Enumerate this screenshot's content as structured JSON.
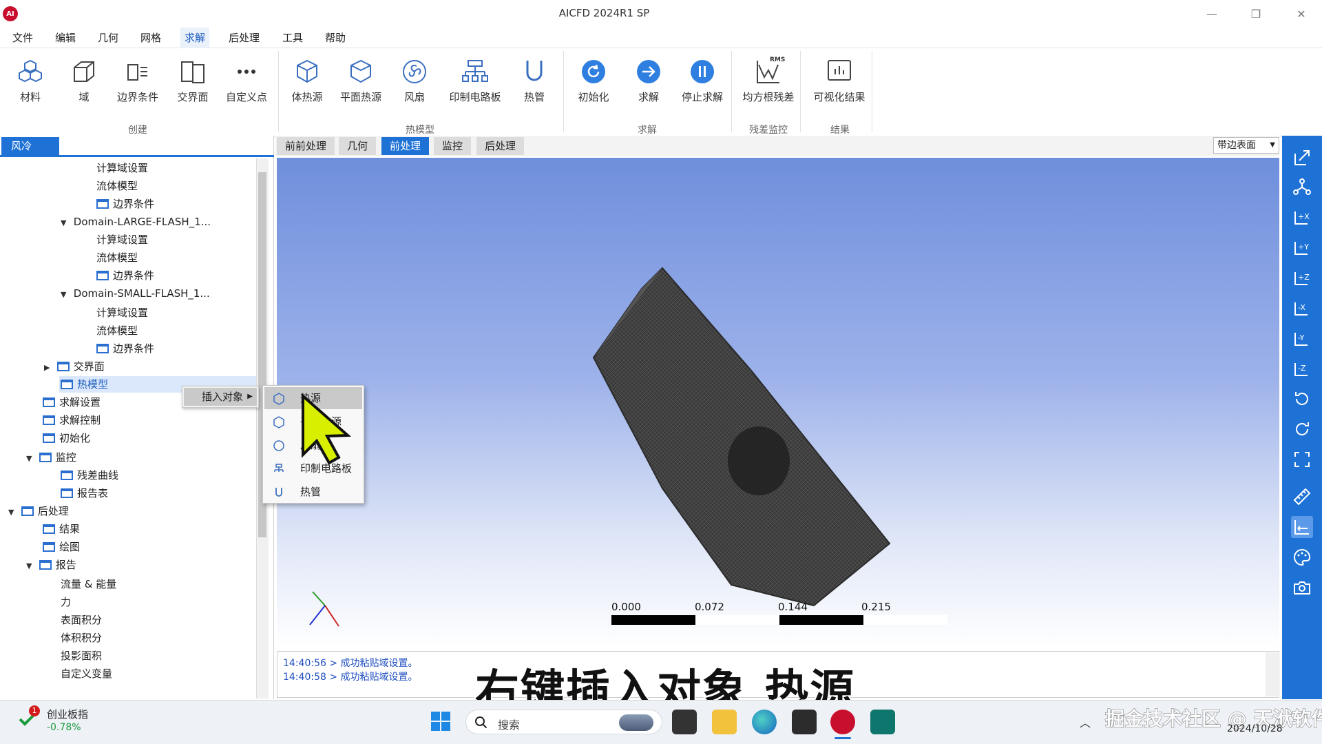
{
  "window": {
    "title": "AICFD 2024R1 SP",
    "logo_text": "AI"
  },
  "menu": [
    "文件",
    "编辑",
    "几何",
    "网格",
    "求解",
    "后处理",
    "工具",
    "帮助"
  ],
  "menu_active_index": 4,
  "ribbon": {
    "buttons": [
      "材料",
      "域",
      "边界条件",
      "交界面",
      "自定义点",
      "体热源",
      "平面热源",
      "风扇",
      "印制电路板",
      "热管",
      "初始化",
      "求解",
      "停止求解",
      "均方根残差",
      "可视化结果"
    ],
    "groups": [
      "创建",
      "热模型",
      "求解",
      "残差监控",
      "结果"
    ],
    "rms_text": "RMS"
  },
  "left_panel": {
    "tab": "风冷",
    "tree": [
      {
        "label": "计算域设置"
      },
      {
        "label": "流体模型"
      },
      {
        "label": "边界条件"
      },
      {
        "label": "Domain-LARGE-FLASH_1..."
      },
      {
        "label": "计算域设置"
      },
      {
        "label": "流体模型"
      },
      {
        "label": "边界条件"
      },
      {
        "label": "Domain-SMALL-FLASH_1..."
      },
      {
        "label": "计算域设置"
      },
      {
        "label": "流体模型"
      },
      {
        "label": "边界条件"
      },
      {
        "label": "交界面"
      },
      {
        "label": "热模型"
      },
      {
        "label": "求解设置"
      },
      {
        "label": "求解控制"
      },
      {
        "label": "初始化"
      },
      {
        "label": "监控"
      },
      {
        "label": "残差曲线"
      },
      {
        "label": "报告表"
      },
      {
        "label": "后处理"
      },
      {
        "label": "结果"
      },
      {
        "label": "绘图"
      },
      {
        "label": "报告"
      },
      {
        "label": "流量 & 能量"
      },
      {
        "label": "力"
      },
      {
        "label": "表面积分"
      },
      {
        "label": "体积积分"
      },
      {
        "label": "投影面积"
      },
      {
        "label": "自定义变量"
      }
    ]
  },
  "context_menu": {
    "insert_label": "插入对象",
    "items": [
      "热源",
      "平面热源",
      "风扇",
      "印制电路板",
      "热管"
    ]
  },
  "view_tabs": [
    "前前处理",
    "几何",
    "前处理",
    "监控",
    "后处理"
  ],
  "view_tab_active_index": 2,
  "display_mode": "带边表面",
  "scale_bar": {
    "labels": [
      "0.000",
      "0.072",
      "0.144",
      "0.215"
    ]
  },
  "console": {
    "lines": [
      "14:40:56 > 成功粘贴域设置。",
      "14:40:58 > 成功粘贴域设置。"
    ]
  },
  "subtitle": "右键插入对象 热源",
  "taskbar": {
    "stock_name": "创业板指",
    "stock_change": "-0.78%",
    "stock_badge": "1",
    "search_placeholder": "搜索",
    "date": "2024/10/28",
    "watermark": "掘金技术社区 @ 天洑软件"
  },
  "colors": {
    "accent": "#1e72d6",
    "stock_down": "#1a9b3c"
  }
}
